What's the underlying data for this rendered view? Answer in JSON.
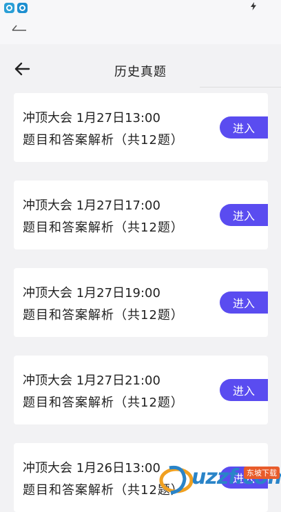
{
  "header": {
    "title": "历史真题"
  },
  "cards": [
    {
      "line1": "冲顶大会 1月27日13:00",
      "line2": "题目和答案解析（共12题）",
      "button": "进入"
    },
    {
      "line1": "冲顶大会 1月27日17:00",
      "line2": "题目和答案解析（共12题）",
      "button": "进入"
    },
    {
      "line1": "冲顶大会 1月27日19:00",
      "line2": "题目和答案解析（共12题）",
      "button": "进入"
    },
    {
      "line1": "冲顶大会 1月27日21:00",
      "line2": "题目和答案解析（共12题）",
      "button": "进入"
    },
    {
      "line1": "冲顶大会 1月26日13:00",
      "line2": "题目和答案解析（共12题）",
      "button": "进入"
    }
  ],
  "watermark": {
    "text": "uzzf.com",
    "badge": "东坡下载"
  },
  "colors": {
    "accent": "#5a4cf0",
    "background": "#f2f2f4",
    "card": "#ffffff"
  },
  "icons": {
    "status_app_1": "app-icon",
    "status_app_2": "app-icon",
    "status_charging": "bolt-icon",
    "back": "arrow-left-icon"
  }
}
